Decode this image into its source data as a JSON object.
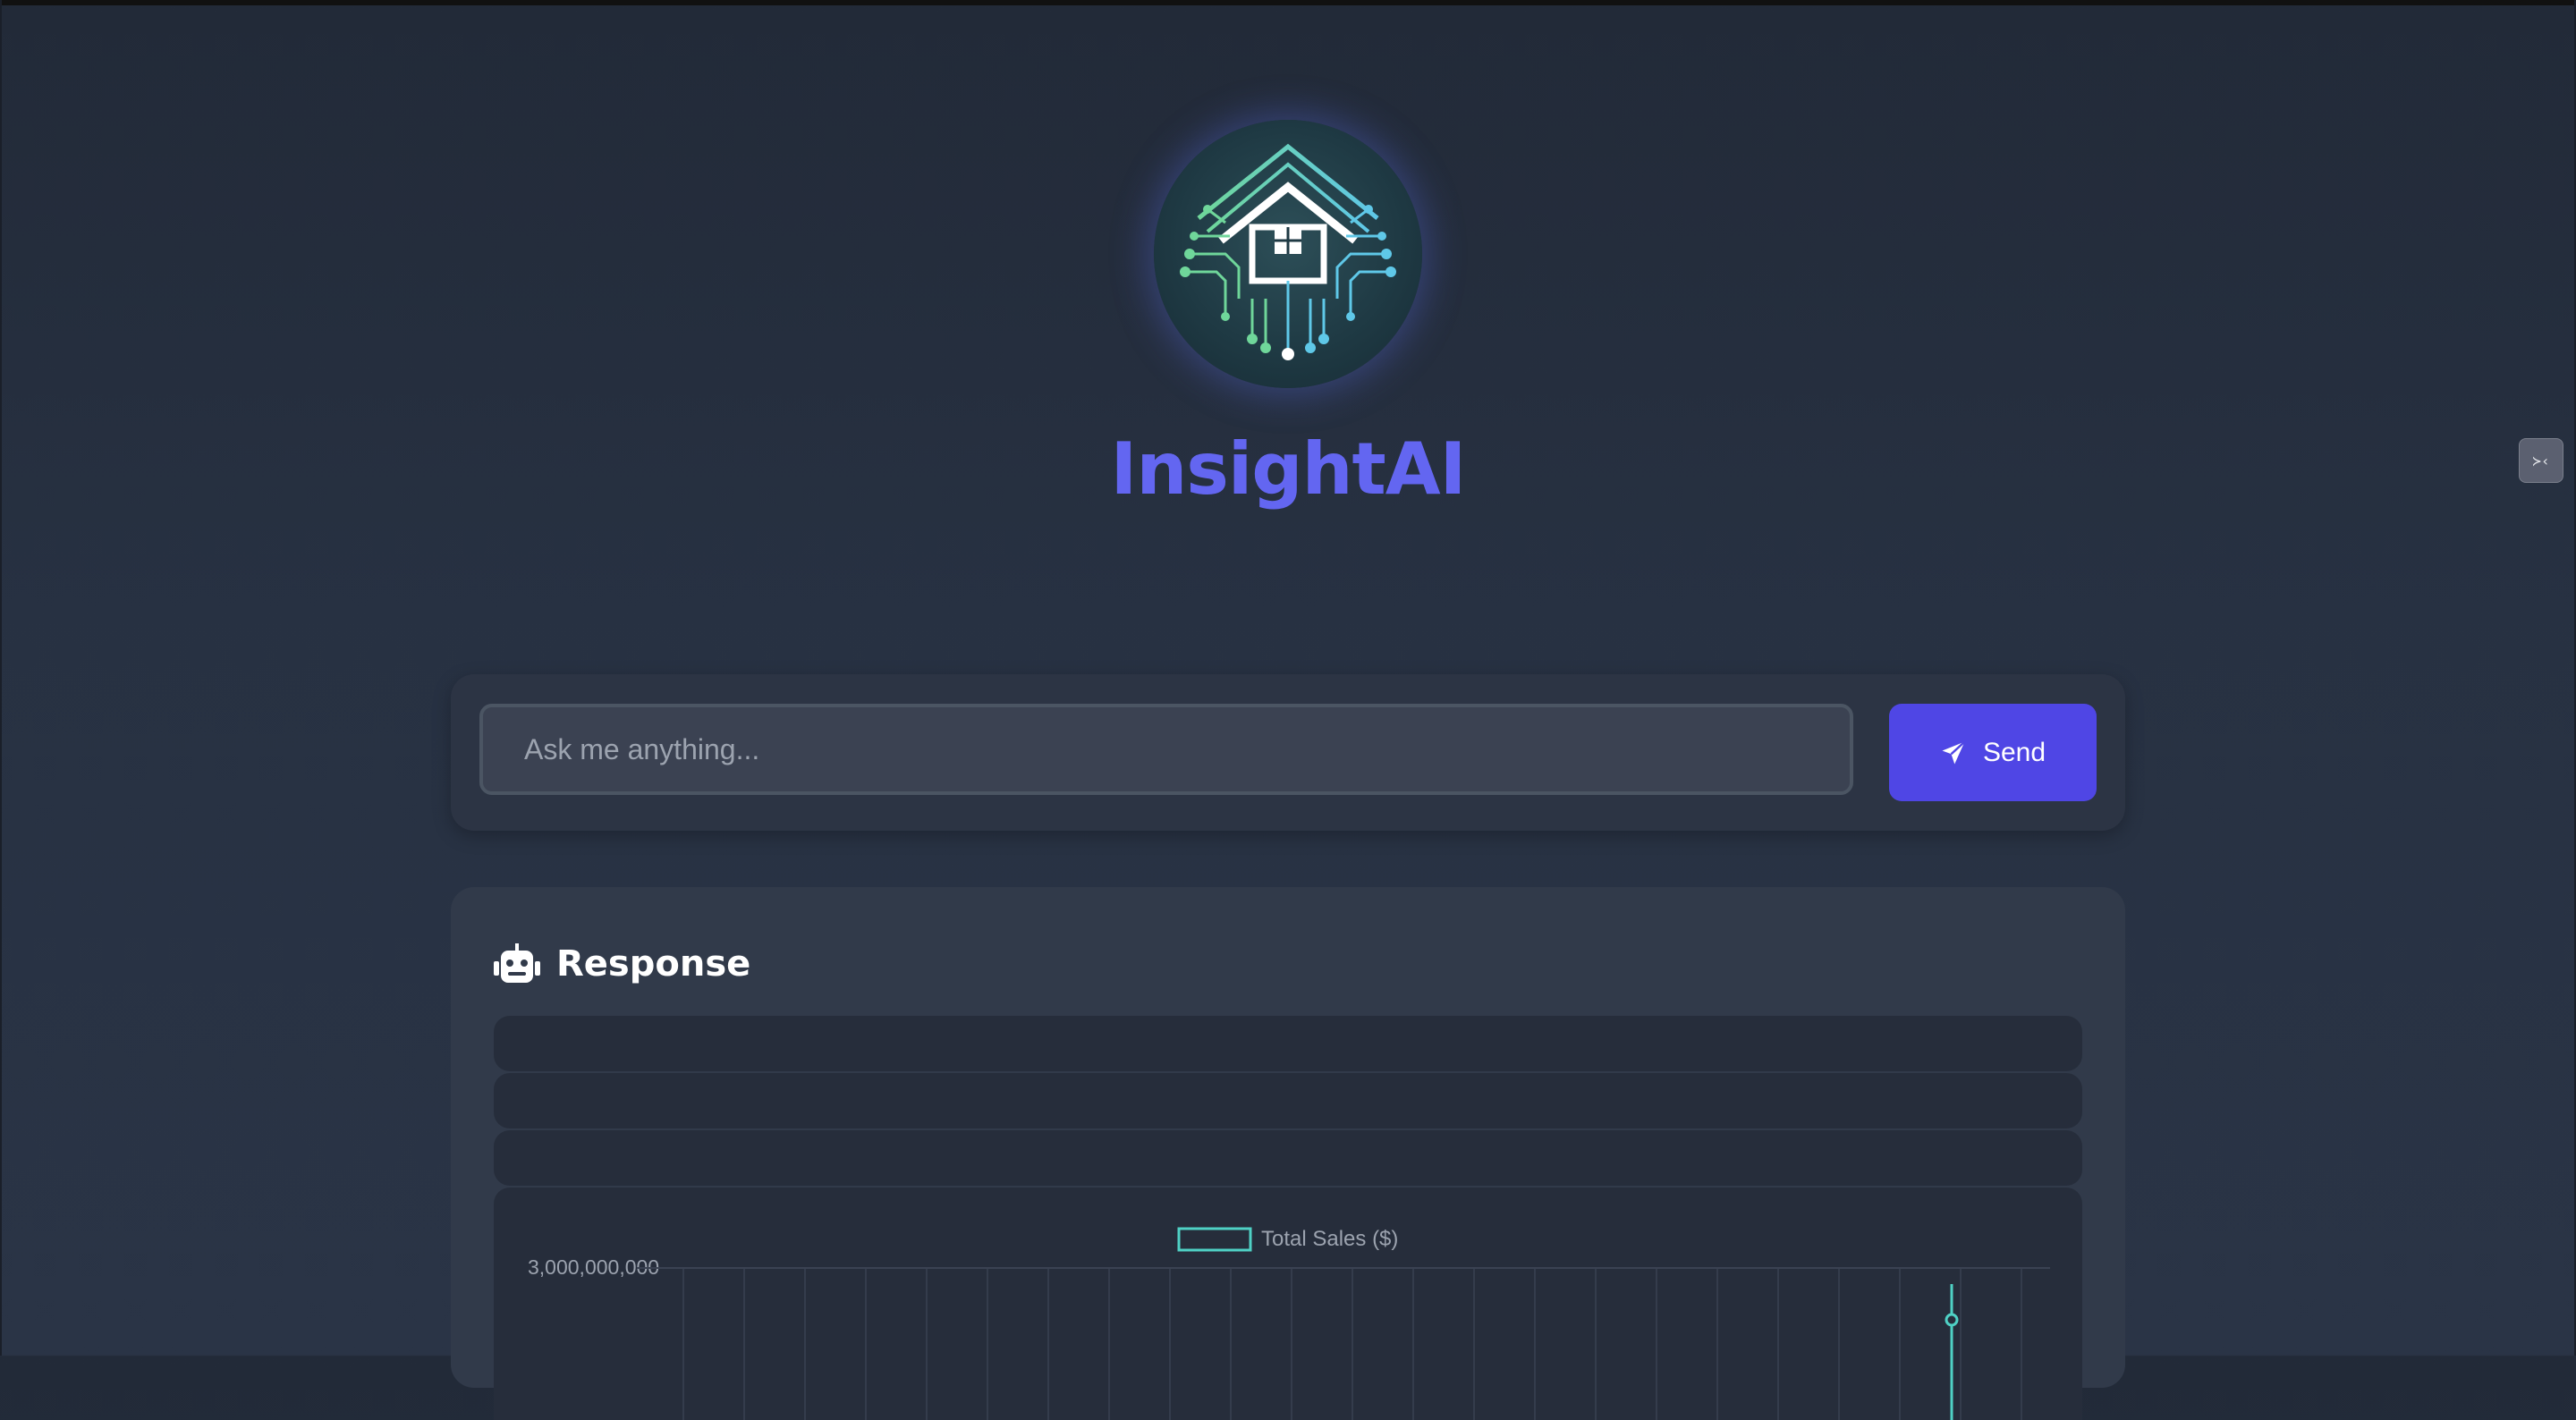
{
  "app": {
    "title": "InsightAI"
  },
  "search": {
    "placeholder": "Ask me anything...",
    "value": ""
  },
  "send_button": {
    "label": "Send"
  },
  "response": {
    "title": "Response"
  },
  "side_widget": {
    "label": "≻‹"
  },
  "colors": {
    "accent": "#6366f1",
    "button": "#4f46e5",
    "series": "#4fd1c5"
  },
  "icons": {
    "send": "paper-plane-icon",
    "response": "robot-icon",
    "logo": "circuit-house-logo"
  },
  "chart_data": {
    "type": "line",
    "legend": [
      "Total Sales ($)"
    ],
    "series": [
      {
        "name": "Total Sales ($)",
        "values": []
      }
    ],
    "y_tick_labels": [
      "3,000,000,000"
    ],
    "legend_placement": "top-center",
    "grid": true
  }
}
